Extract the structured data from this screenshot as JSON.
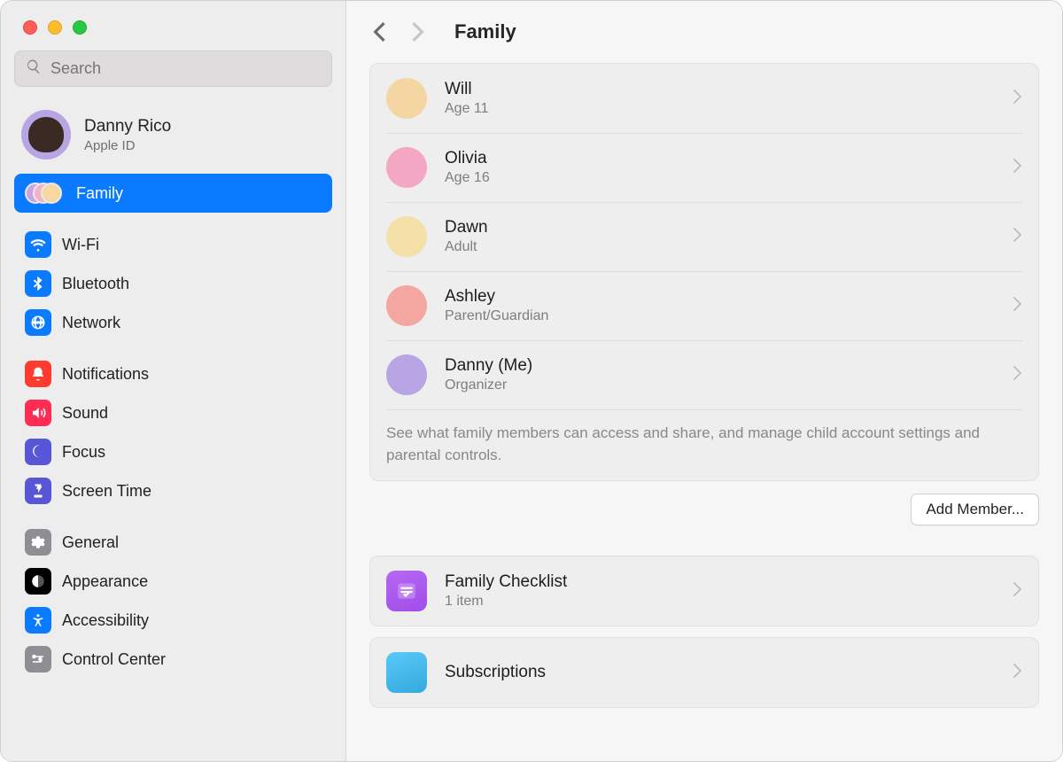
{
  "sidebar": {
    "search_placeholder": "Search",
    "account": {
      "name": "Danny Rico",
      "sub": "Apple ID",
      "avatar_color": "#b8a5e3"
    },
    "items": [
      {
        "id": "family",
        "label": "Family",
        "icon": "family",
        "selected": true
      },
      {
        "id": "wifi",
        "label": "Wi-Fi",
        "icon": "wifi"
      },
      {
        "id": "bluetooth",
        "label": "Bluetooth",
        "icon": "bluetooth"
      },
      {
        "id": "network",
        "label": "Network",
        "icon": "network"
      },
      {
        "id": "notifications",
        "label": "Notifications",
        "icon": "notifications"
      },
      {
        "id": "sound",
        "label": "Sound",
        "icon": "sound"
      },
      {
        "id": "focus",
        "label": "Focus",
        "icon": "focus"
      },
      {
        "id": "screentime",
        "label": "Screen Time",
        "icon": "screentime"
      },
      {
        "id": "general",
        "label": "General",
        "icon": "general"
      },
      {
        "id": "appearance",
        "label": "Appearance",
        "icon": "appearance"
      },
      {
        "id": "accessibility",
        "label": "Accessibility",
        "icon": "accessibility"
      },
      {
        "id": "controlcenter",
        "label": "Control Center",
        "icon": "controlcenter"
      }
    ]
  },
  "header": {
    "title": "Family"
  },
  "members": [
    {
      "name": "Will",
      "sub": "Age 11",
      "avatar_color": "#f4d6a2"
    },
    {
      "name": "Olivia",
      "sub": "Age 16",
      "avatar_color": "#f3a7c2"
    },
    {
      "name": "Dawn",
      "sub": "Adult",
      "avatar_color": "#f5e0a8"
    },
    {
      "name": "Ashley",
      "sub": "Parent/Guardian",
      "avatar_color": "#f3a7a0"
    },
    {
      "name": "Danny (Me)",
      "sub": "Organizer",
      "avatar_color": "#b8a5e3"
    }
  ],
  "members_note": "See what family members can access and share, and manage child account settings and parental controls.",
  "add_member_label": "Add Member...",
  "checklist": {
    "title": "Family Checklist",
    "sub": "1 item"
  },
  "subscriptions": {
    "title": "Subscriptions"
  }
}
